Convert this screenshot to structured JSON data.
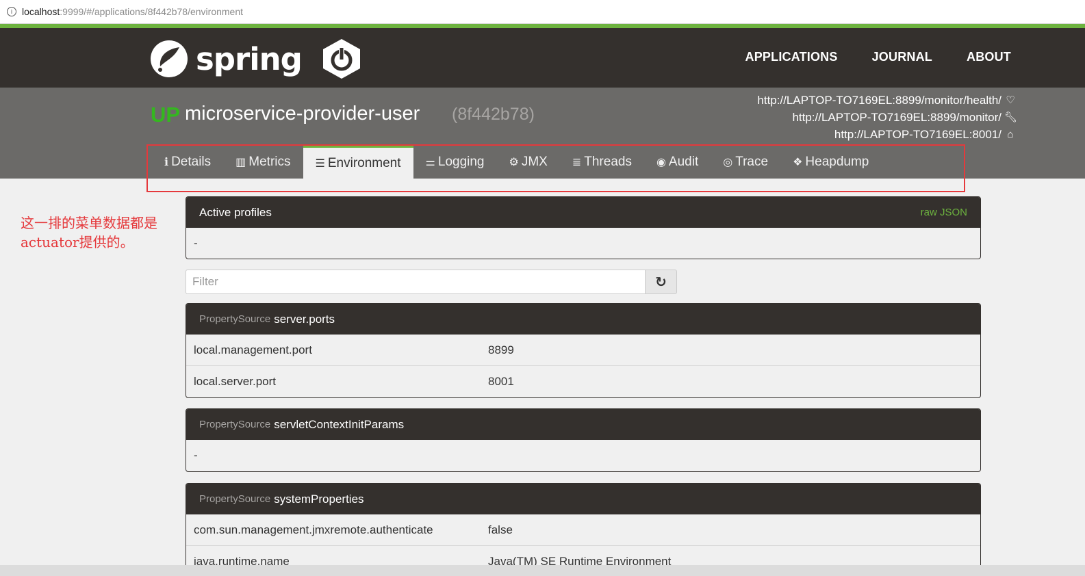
{
  "browser": {
    "url_host": "localhost",
    "url_rest": ":9999/#/applications/8f442b78/environment"
  },
  "brand": {
    "wordmark": "spring"
  },
  "nav": {
    "applications": "APPLICATIONS",
    "journal": "JOURNAL",
    "about": "ABOUT"
  },
  "app": {
    "status": "UP",
    "name": "microservice-provider-user",
    "id": "(8f442b78)",
    "health_url": "http://LAPTOP-TO7169EL:8899/monitor/health/",
    "management_url": "http://LAPTOP-TO7169EL:8899/monitor/",
    "service_url": "http://LAPTOP-TO7169EL:8001/"
  },
  "tabs": [
    {
      "label": "Details",
      "icon": "info-icon"
    },
    {
      "label": "Metrics",
      "icon": "bar-chart-icon"
    },
    {
      "label": "Environment",
      "icon": "server-icon"
    },
    {
      "label": "Logging",
      "icon": "sliders-icon"
    },
    {
      "label": "JMX",
      "icon": "cogs-icon"
    },
    {
      "label": "Threads",
      "icon": "list-icon"
    },
    {
      "label": "Audit",
      "icon": "user-circle-icon"
    },
    {
      "label": "Trace",
      "icon": "eye-icon"
    },
    {
      "label": "Heapdump",
      "icon": "cubes-icon"
    }
  ],
  "annotation": {
    "line1": "这一排的菜单数据都是",
    "line2": "actuator提供的。"
  },
  "profiles": {
    "title": "Active profiles",
    "raw_link": "raw JSON",
    "value": "-"
  },
  "filter": {
    "placeholder": "Filter"
  },
  "sources": {
    "prefix": "PropertySource",
    "server_ports": {
      "name": "server.ports",
      "rows": [
        {
          "key": "local.management.port",
          "value": "8899"
        },
        {
          "key": "local.server.port",
          "value": "8001"
        }
      ]
    },
    "servlet": {
      "name": "servletContextInitParams",
      "value": "-"
    },
    "system": {
      "name": "systemProperties",
      "rows": [
        {
          "key": "com.sun.management.jmxremote.authenticate",
          "value": "false"
        },
        {
          "key": "java.runtime.name",
          "value": "Java(TM) SE Runtime Environment"
        }
      ]
    }
  }
}
